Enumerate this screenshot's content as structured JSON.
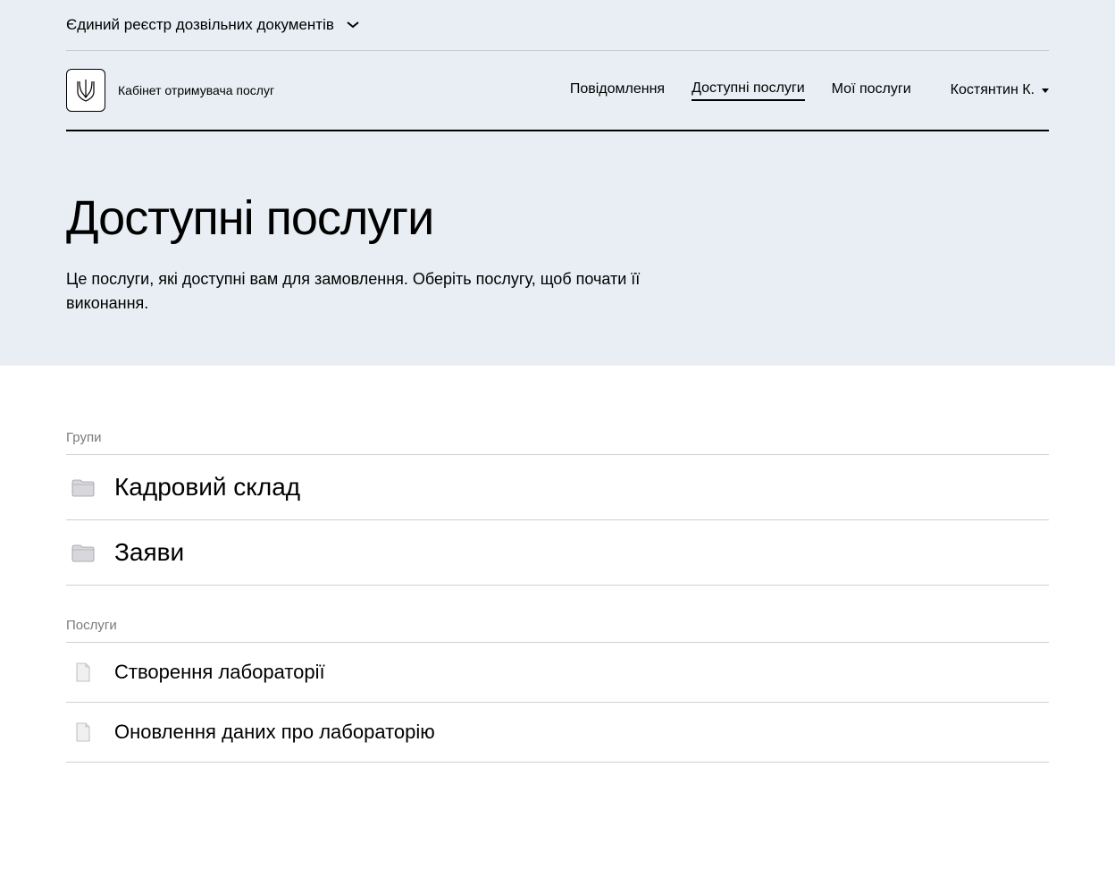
{
  "registry": {
    "label": "Єдиний реєстр дозвільних документів"
  },
  "header": {
    "logo_text": "Кабінет отримувача послуг",
    "nav": [
      {
        "label": "Повідомлення",
        "active": false
      },
      {
        "label": "Доступні послуги",
        "active": true
      },
      {
        "label": "Мої послуги",
        "active": false
      }
    ],
    "user": {
      "name": "Костянтин К."
    }
  },
  "page": {
    "title": "Доступні послуги",
    "description": "Це послуги, які доступні вам для замовлення. Оберіть послугу, щоб почати її виконання."
  },
  "sections": {
    "groups_label": "Групи",
    "services_label": "Послуги",
    "groups": [
      {
        "title": "Кадровий склад"
      },
      {
        "title": "Заяви"
      }
    ],
    "services": [
      {
        "title": "Створення лабораторії"
      },
      {
        "title": "Оновлення даних про лабораторію"
      }
    ]
  }
}
